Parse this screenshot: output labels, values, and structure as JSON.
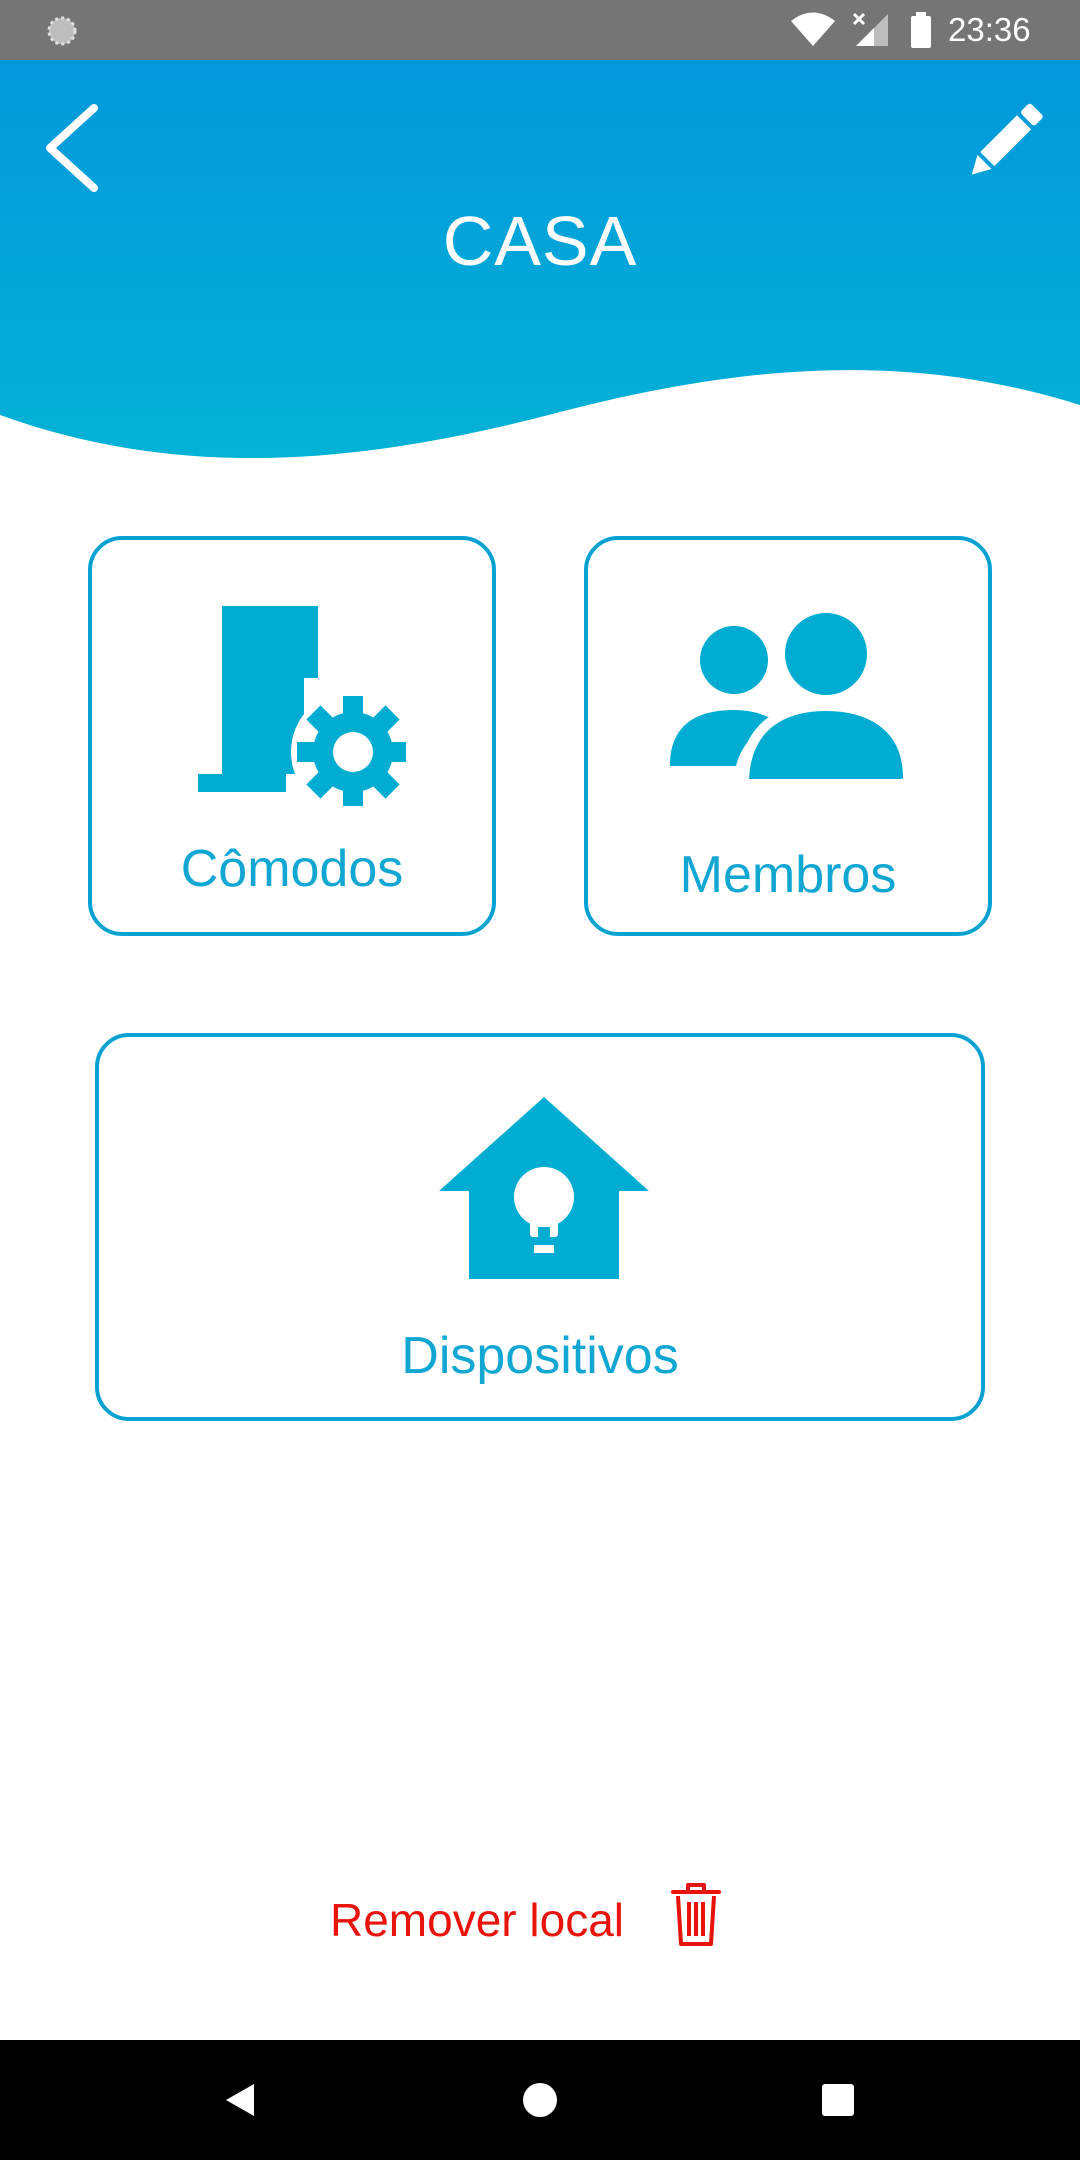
{
  "status_bar": {
    "time": "23:36",
    "icons": [
      "notification-icon",
      "wifi-icon",
      "signal-icon",
      "battery-icon"
    ]
  },
  "header": {
    "title": "CASA",
    "back_icon": "chevron-left-icon",
    "edit_icon": "pencil-icon",
    "gradient_top": "#0398dc",
    "gradient_bottom": "#04b2d6"
  },
  "cards": {
    "comodos": {
      "label": "Cômodos",
      "icon": "room-settings-icon"
    },
    "membros": {
      "label": "Membros",
      "icon": "members-icon"
    },
    "dispositivos": {
      "label": "Dispositivos",
      "icon": "house-bulb-icon"
    }
  },
  "remove": {
    "label": "Remover local",
    "icon": "trash-icon",
    "color": "#e8140c"
  },
  "colors": {
    "accent": "#0aa2d2",
    "icon_fill": "#01acd2"
  },
  "nav_bar": {
    "buttons": [
      "back-triangle-icon",
      "home-circle-icon",
      "recents-square-icon"
    ]
  }
}
